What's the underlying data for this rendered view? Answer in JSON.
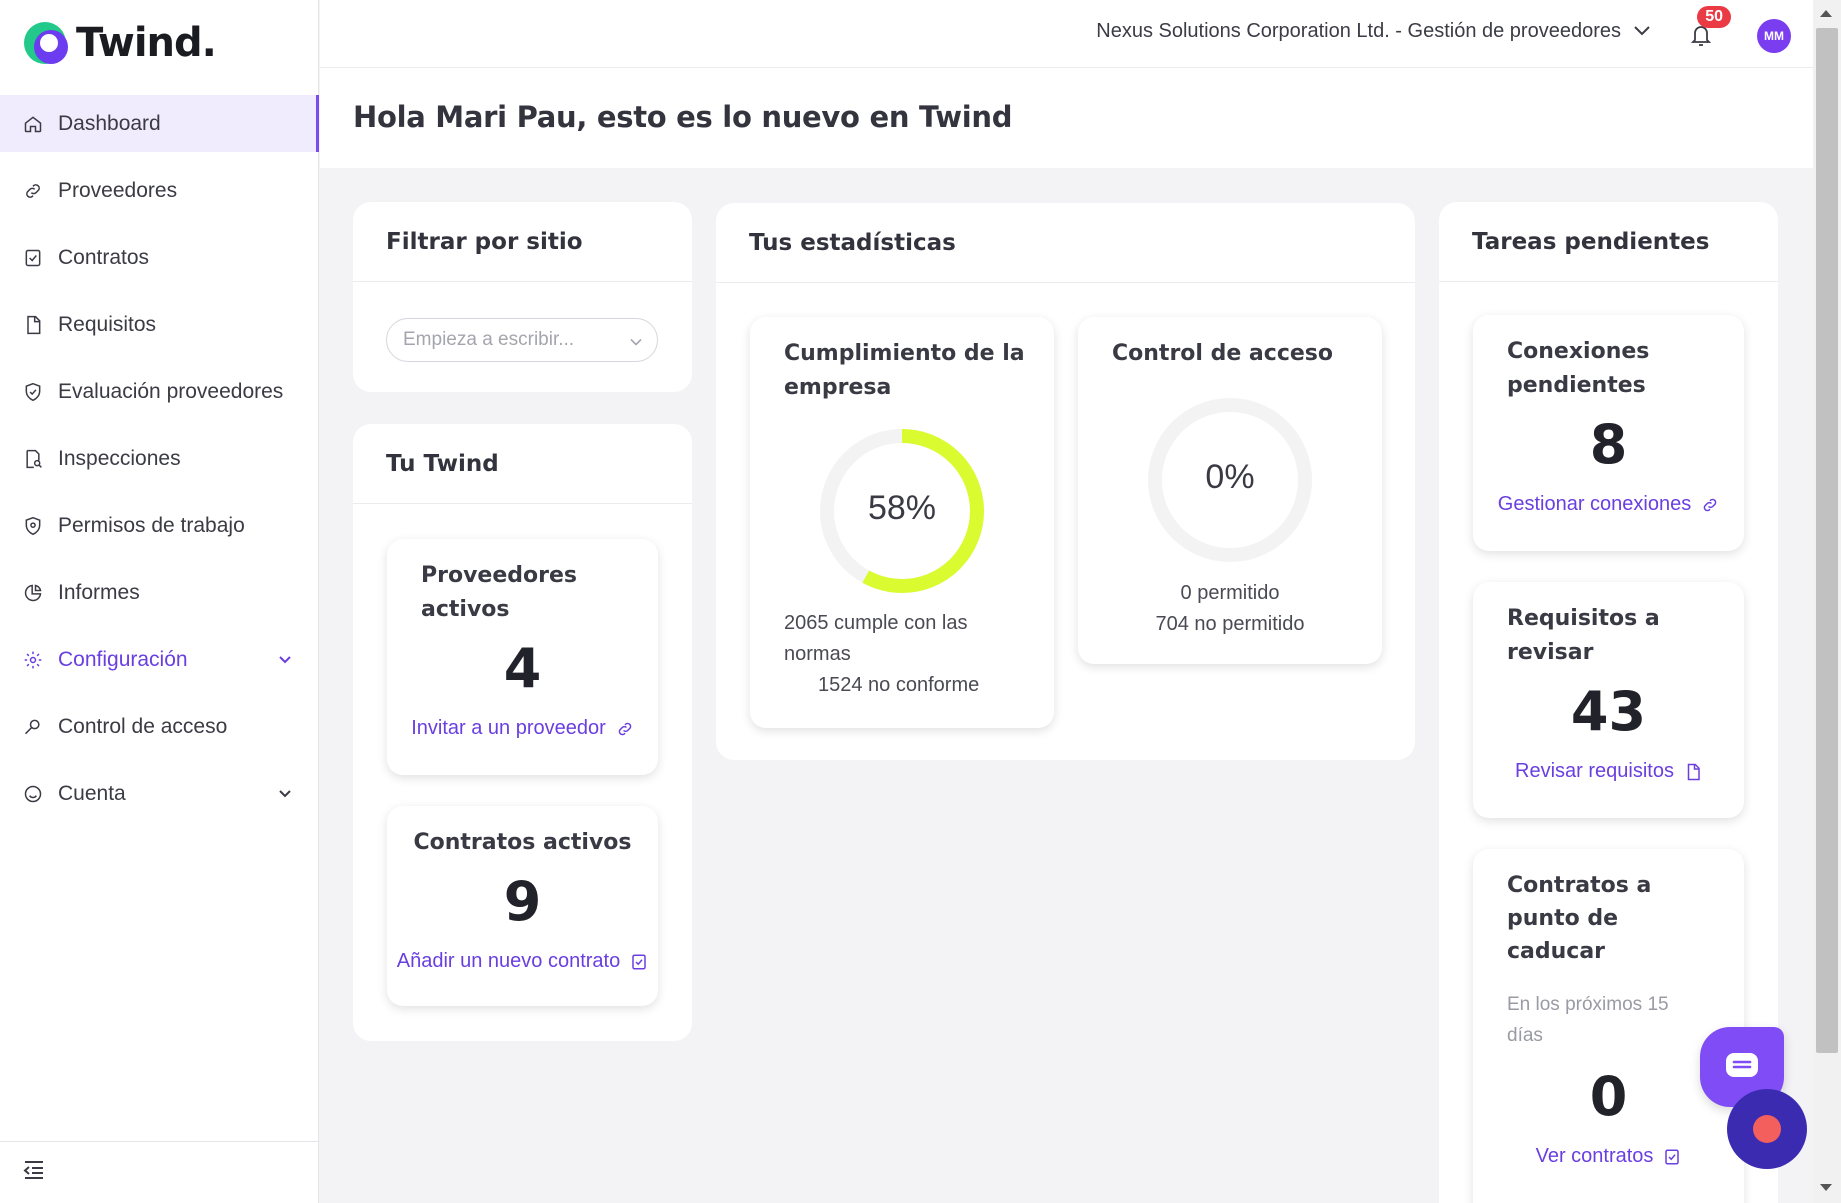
{
  "brand": {
    "name": "Twind."
  },
  "sidebar": {
    "items": [
      {
        "label": "Dashboard",
        "icon": "home-icon"
      },
      {
        "label": "Proveedores",
        "icon": "link-icon"
      },
      {
        "label": "Contratos",
        "icon": "contract-icon"
      },
      {
        "label": "Requisitos",
        "icon": "file-icon"
      },
      {
        "label": "Evaluación proveedores",
        "icon": "shield-check-icon"
      },
      {
        "label": "Inspecciones",
        "icon": "search-doc-icon"
      },
      {
        "label": "Permisos de trabajo",
        "icon": "shield-icon"
      },
      {
        "label": "Informes",
        "icon": "pie-icon"
      },
      {
        "label": "Configuración",
        "icon": "gear-icon"
      },
      {
        "label": "Control de acceso",
        "icon": "key-icon"
      },
      {
        "label": "Cuenta",
        "icon": "smile-icon"
      }
    ]
  },
  "topbar": {
    "org": "Nexus Solutions Corporation Ltd. - Gestión de proveedores",
    "notifications": "50",
    "avatar": "MM"
  },
  "greeting": "Hola Mari Pau, esto es lo nuevo en Twind",
  "filter": {
    "title": "Filtrar por sitio",
    "placeholder": "Empieza a escribir..."
  },
  "tu_twind": {
    "title": "Tu Twind",
    "proveedores": {
      "title_line1": "Proveedores",
      "title_line2": "activos",
      "value": "4",
      "link": "Invitar a un proveedor"
    },
    "contratos": {
      "title": "Contratos activos",
      "value": "9",
      "link": "Añadir un nuevo contrato"
    }
  },
  "stats": {
    "title": "Tus estadísticas",
    "cumplimiento": {
      "title_line1": "Cumplimiento de la",
      "title_line2": "empresa",
      "percent_label": "58%",
      "percent": 58,
      "line1": "2065 cumple con las",
      "line2": "normas",
      "line3": "1524 no conforme",
      "color": "#d9fb2f"
    },
    "acceso": {
      "title": "Control de acceso",
      "percent_label": "0%",
      "percent": 0,
      "line1": "0 permitido",
      "line2": "704 no permitido"
    }
  },
  "tareas": {
    "title": "Tareas pendientes",
    "conexiones": {
      "title_line1": "Conexiones",
      "title_line2": "pendientes",
      "value": "8",
      "link": "Gestionar conexiones"
    },
    "requisitos": {
      "title_line1": "Requisitos a",
      "title_line2": "revisar",
      "value": "43",
      "link": "Revisar requisitos"
    },
    "caducar": {
      "title_line1": "Contratos a",
      "title_line2": "punto de",
      "title_line3": "caducar",
      "sub_line1": "En los próximos 15",
      "sub_line2": "días",
      "value": "0",
      "link": "Ver contratos"
    }
  },
  "colors": {
    "accent": "#6a3fe0",
    "badge": "#ea3b45",
    "gauge": "#d9fb2f"
  }
}
